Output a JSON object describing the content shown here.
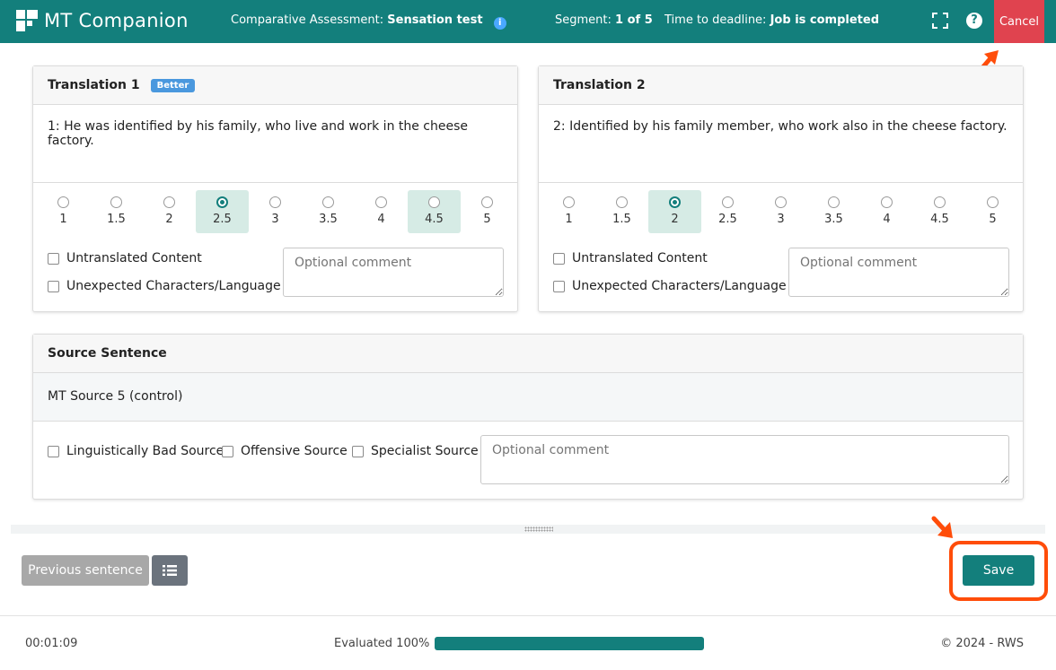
{
  "header": {
    "app_name": "MT Companion",
    "assessment_label": "Comparative Assessment:",
    "assessment_name": "Sensation test",
    "segment_label": "Segment:",
    "segment_value": "1 of 5",
    "deadline_label": "Time to deadline:",
    "deadline_value": "Job is completed",
    "cancel_label": "Cancel",
    "info_icon": "i",
    "help_icon": "?"
  },
  "translations": [
    {
      "title": "Translation 1",
      "badge": "Better",
      "text": "1: He was identified by his family, who live and work in the cheese factory.",
      "scale": [
        "1",
        "1.5",
        "2",
        "2.5",
        "3",
        "3.5",
        "4",
        "4.5",
        "5"
      ],
      "selected": "2.5",
      "highlighted": [
        "2.5",
        "4.5"
      ],
      "checks": [
        "Untranslated Content",
        "Unexpected Characters/Language"
      ],
      "comment_placeholder": "Optional comment"
    },
    {
      "title": "Translation 2",
      "badge": "",
      "text": "2: Identified by his family member, who work also in the cheese factory.",
      "scale": [
        "1",
        "1.5",
        "2",
        "2.5",
        "3",
        "3.5",
        "4",
        "4.5",
        "5"
      ],
      "selected": "2",
      "highlighted": [
        "2"
      ],
      "checks": [
        "Untranslated Content",
        "Unexpected Characters/Language"
      ],
      "comment_placeholder": "Optional comment"
    }
  ],
  "source": {
    "title": "Source Sentence",
    "text": "MT Source 5 (control)",
    "checks": [
      "Linguistically Bad Source",
      "Offensive Source",
      "Specialist Source"
    ],
    "comment_placeholder": "Optional comment"
  },
  "actions": {
    "previous_label": "Previous sentence",
    "save_label": "Save"
  },
  "footer": {
    "time": "00:01:09",
    "evaluated_label": "Evaluated 100%",
    "progress": 1.0,
    "copyright": "© 2024 - RWS"
  },
  "colors": {
    "brand": "#137f7c",
    "cancel": "#e0434f",
    "badge": "#4a98de",
    "highlight": "#d6ebe5",
    "annotation": "#ff4d0a"
  }
}
